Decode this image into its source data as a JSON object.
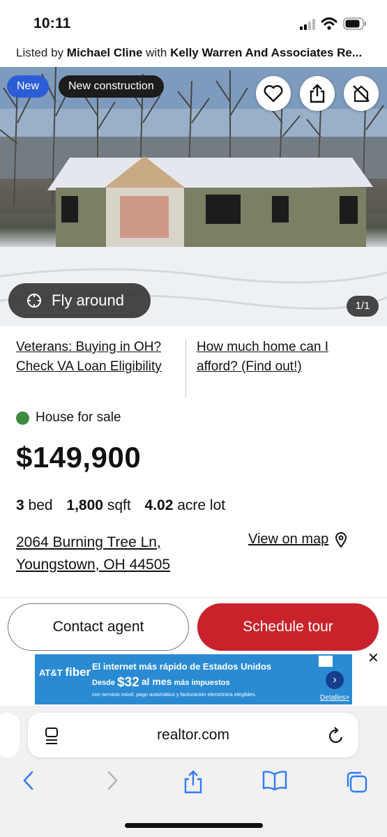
{
  "status_bar": {
    "time": "10:11"
  },
  "listing_credit": {
    "prefix": "Listed by",
    "agent": "Michael Cline",
    "with": "with",
    "brokerage": "Kelly Warren And Associates Re..."
  },
  "hero": {
    "badges": {
      "new": "New",
      "new_construction": "New construction"
    },
    "fly_around": "Fly around",
    "photo_counter": "1/1"
  },
  "promos": {
    "left": "Veterans: Buying in OH? Check VA Loan Eligibility",
    "right": "How much home can I afford? (Find out!)"
  },
  "listing": {
    "status": "House for sale",
    "status_color": "#3d8b40",
    "price": "$149,900",
    "beds": "3",
    "beds_label": "bed",
    "sqft": "1,800",
    "sqft_label": "sqft",
    "lot": "4.02",
    "lot_label": "acre lot",
    "address_line1": "2064 Burning Tree Ln,",
    "address_line2": "Youngstown, OH 44505",
    "view_on_map": "View on map"
  },
  "actions": {
    "contact": "Contact agent",
    "tour": "Schedule tour",
    "tour_color": "#c8222b"
  },
  "ad": {
    "brand_small": "AT&T",
    "brand_big": "fiber",
    "headline": "El internet más rápido de Estados Unidos",
    "desde": "Desde",
    "price": "$32",
    "al_mes": "al mes",
    "impuestos": "más impuestos",
    "fine": "con servicio móvil, pago automático y facturación electrónica elegibles.",
    "details": "Detalles>"
  },
  "browser": {
    "url": "realtor.com"
  }
}
